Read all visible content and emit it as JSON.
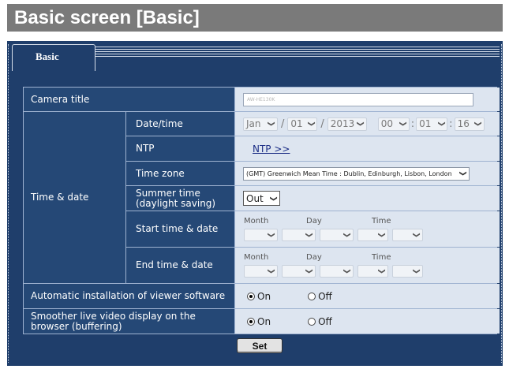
{
  "doc_title": "Basic screen [Basic]",
  "tab": {
    "label": "Basic"
  },
  "rows": {
    "camera_title": {
      "label": "Camera title",
      "value": "AW-HE130K"
    },
    "time_and_date": {
      "label": "Time & date"
    },
    "date_time": {
      "label": "Date/time",
      "month": "Jan",
      "day": "01",
      "year": "2013",
      "hour": "00",
      "minute": "01",
      "second": "16",
      "date_sep": "/",
      "time_sep": ":"
    },
    "ntp": {
      "label": "NTP",
      "link": "NTP >>"
    },
    "time_zone": {
      "label": "Time zone",
      "value": "(GMT) Greenwich Mean Time : Dublin, Edinburgh, Lisbon, London"
    },
    "summer_time": {
      "label": "Summer time\n(daylight saving)",
      "value": "Out"
    },
    "start_time": {
      "label": "Start time & date",
      "month_head": "Month",
      "day_head": "Day",
      "time_head": "Time"
    },
    "end_time": {
      "label": "End time & date",
      "month_head": "Month",
      "day_head": "Day",
      "time_head": "Time"
    },
    "auto_install": {
      "label": "Automatic installation of viewer software",
      "on": "On",
      "off": "Off",
      "selected": "On"
    },
    "smoother": {
      "label": "Smoother live video display on the browser (buffering)",
      "on": "On",
      "off": "Off",
      "selected": "On"
    }
  },
  "set_button": "Set",
  "icons": {
    "dropdown": "chevron-down-icon",
    "radio": "radio-icon"
  }
}
